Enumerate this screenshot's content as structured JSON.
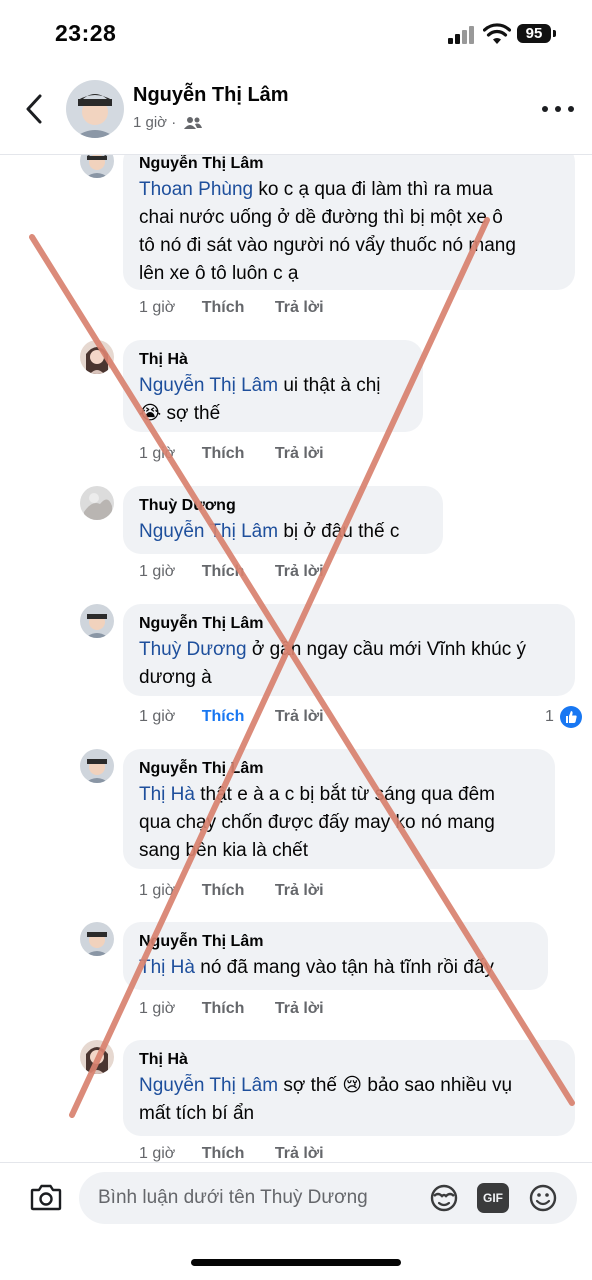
{
  "status_bar": {
    "time": "23:28",
    "battery": "95"
  },
  "header": {
    "name": "Nguyễn Thị Lâm",
    "time": "1 giờ",
    "separator": "·"
  },
  "comments": [
    {
      "author": "Nguyễn Thị Lâm",
      "mention": "Thoan Phùng",
      "line1": "ko c ạ qua đi làm thì ra mua",
      "line2": "chai nước uống ở dề đường thì bị một xe ô",
      "line3": "tô nó đi sát vào người nó vẩy thuốc nó mang",
      "line4": "lên xe ô tô luôn c ạ",
      "time": "1 giờ",
      "like": "Thích",
      "reply": "Trả lời"
    },
    {
      "author": "Thị Hà",
      "mention": "Nguyễn Thị Lâm",
      "line1": " ui thật à chị",
      "emoji": "😭",
      "line2": " sợ thế",
      "time": "1 giờ",
      "like": "Thích",
      "reply": "Trả lời"
    },
    {
      "author": "Thuỳ Dương",
      "mention": "Nguyễn Thị Lâm",
      "line1": " bị ở đâu thế c",
      "time": "1 giờ",
      "like": "Thích",
      "reply": "Trả lời"
    },
    {
      "author": "Nguyễn Thị Lâm",
      "mention": "Thuỳ Dương",
      "line1": " ở gần ngay cầu mới Vĩnh khúc ý",
      "line2": "dương à",
      "time": "1 giờ",
      "like": "Thích",
      "reply": "Trả lời",
      "reactions": "1"
    },
    {
      "author": "Nguyễn Thị Lâm",
      "mention": "Thị Hà",
      "line1": " thật e à  a c bị bắt từ sáng qua đêm",
      "line2": "qua chạy chốn được đấy may ko nó mang",
      "line3": "sang bên kia là chết",
      "time": "1 giờ",
      "like": "Thích",
      "reply": "Trả lời"
    },
    {
      "author": "Nguyễn Thị Lâm",
      "mention": "Thị Hà",
      "line1": " nó đã mang vào tận hà tĩnh rồi đấy",
      "time": "1 giờ",
      "like": "Thích",
      "reply": "Trả lời"
    },
    {
      "author": "Thị Hà",
      "mention": "Nguyễn Thị Lâm",
      "line1": " sợ thế ",
      "emoji": "😢",
      "line1b": " bảo sao nhiều vụ",
      "line2": "mất tích bí ẩn",
      "time": "1 giờ",
      "like": "Thích",
      "reply": "Trả lời"
    }
  ],
  "composer": {
    "placeholder": "Bình luận dưới tên Thuỳ Dương",
    "gif": "GIF"
  },
  "colors": {
    "mention": "#1e4f9c",
    "bubble": "#f0f2f5",
    "cross": "#d9826f",
    "like_active": "#1877f2"
  }
}
